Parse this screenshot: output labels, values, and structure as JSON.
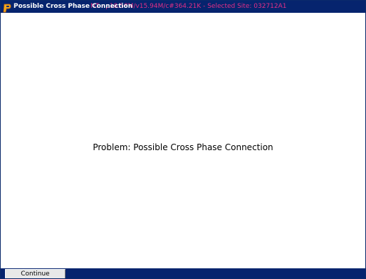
{
  "window": {
    "title": "Possible Cross Phase Connection",
    "title_overlay": "NT - p18.58M/v15.94M/c#364.21K - Selected Site: 032712A1",
    "icon": "app-logo-icon"
  },
  "main": {
    "message": "Problem: Possible Cross Phase Connection"
  },
  "footer": {
    "continue_label": "Continue"
  },
  "colors": {
    "titlebar": "#06246e",
    "title_overlay_text": "#e02f86",
    "background": "#ffffff"
  }
}
